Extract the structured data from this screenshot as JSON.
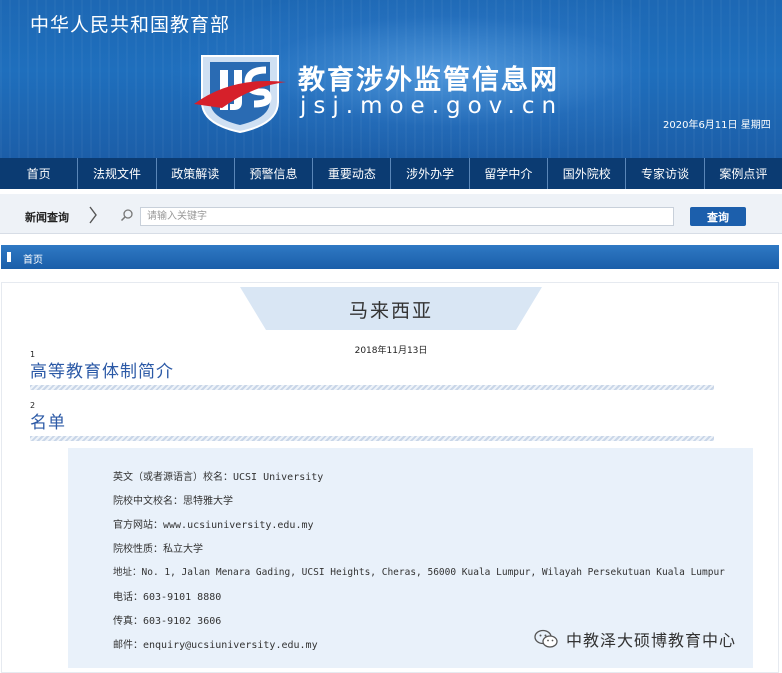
{
  "header": {
    "ministry": "中华人民共和国教育部",
    "site_title": "教育涉外监管信息网",
    "site_domain": "jsj.moe.gov.cn",
    "date": "2020年6月11日  星期四"
  },
  "nav": {
    "items": [
      {
        "label": "首页"
      },
      {
        "label": "法规文件"
      },
      {
        "label": "政策解读"
      },
      {
        "label": "预警信息"
      },
      {
        "label": "重要动态"
      },
      {
        "label": "涉外办学"
      },
      {
        "label": "留学中介"
      },
      {
        "label": "国外院校"
      },
      {
        "label": "专家访谈"
      },
      {
        "label": "案例点评"
      }
    ]
  },
  "search": {
    "label": "新闻查询",
    "placeholder": "请输入关键字",
    "button": "查询"
  },
  "breadcrumb": {
    "home": "首页"
  },
  "article": {
    "country": "马来西亚",
    "date": "2018年11月13日",
    "sections": [
      {
        "num": "1",
        "title": "高等教育体制简介"
      },
      {
        "num": "2",
        "title": "名单"
      }
    ],
    "info": [
      {
        "key": "英文（或者源语言）校名：",
        "value": "UCSI University"
      },
      {
        "key": "院校中文校名：",
        "value": "思特雅大学"
      },
      {
        "key": "官方网站：",
        "value": "www.ucsiuniversity.edu.my"
      },
      {
        "key": "院校性质：",
        "value": "私立大学"
      },
      {
        "key": "地址：",
        "value": "No. 1, Jalan Menara Gading, UCSI Heights, Cheras, 56000 Kuala Lumpur, Wilayah Persekutuan Kuala Lumpur"
      },
      {
        "key": "电话：",
        "value": "603-9101 8880"
      },
      {
        "key": "传真：",
        "value": "603-9102 3606"
      },
      {
        "key": "邮件：",
        "value": "enquiry@ucsiuniversity.edu.my"
      }
    ]
  },
  "watermark": {
    "text": "中教泽大硕博教育中心"
  },
  "colors": {
    "header_blue": "#1f6fbd",
    "nav_navy": "#0b3b72",
    "title_blue": "#2b59a6",
    "info_bg": "#e9f1fa",
    "logo_red": "#d6202a"
  }
}
